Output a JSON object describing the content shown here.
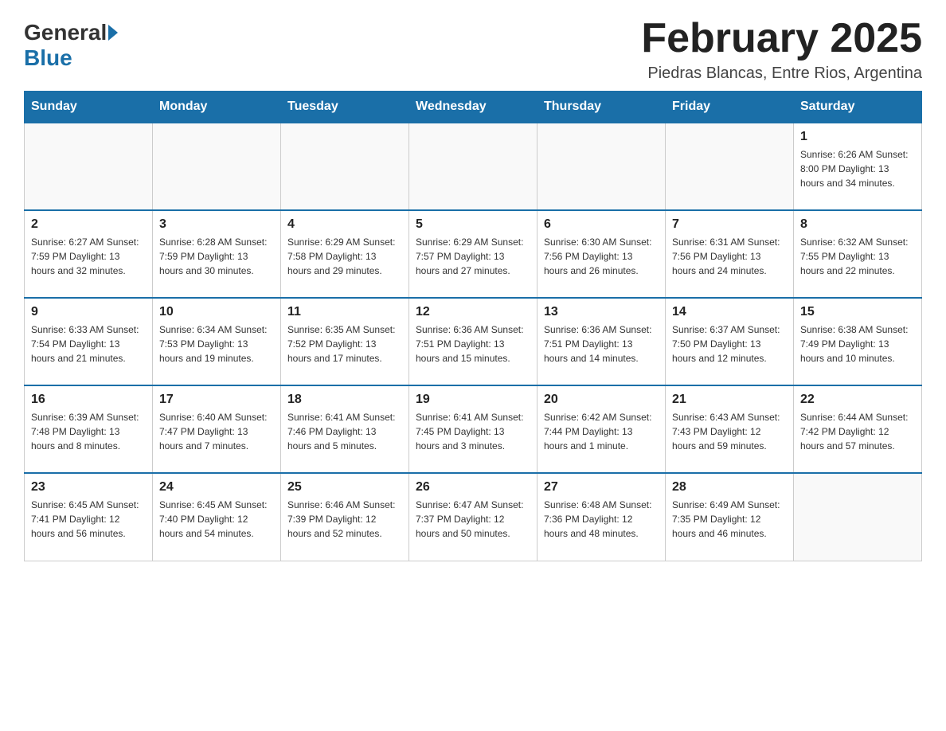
{
  "header": {
    "logo_general": "General",
    "logo_blue": "Blue",
    "title": "February 2025",
    "location": "Piedras Blancas, Entre Rios, Argentina"
  },
  "weekdays": [
    "Sunday",
    "Monday",
    "Tuesday",
    "Wednesday",
    "Thursday",
    "Friday",
    "Saturday"
  ],
  "weeks": [
    [
      {
        "day": "",
        "info": ""
      },
      {
        "day": "",
        "info": ""
      },
      {
        "day": "",
        "info": ""
      },
      {
        "day": "",
        "info": ""
      },
      {
        "day": "",
        "info": ""
      },
      {
        "day": "",
        "info": ""
      },
      {
        "day": "1",
        "info": "Sunrise: 6:26 AM\nSunset: 8:00 PM\nDaylight: 13 hours and 34 minutes."
      }
    ],
    [
      {
        "day": "2",
        "info": "Sunrise: 6:27 AM\nSunset: 7:59 PM\nDaylight: 13 hours and 32 minutes."
      },
      {
        "day": "3",
        "info": "Sunrise: 6:28 AM\nSunset: 7:59 PM\nDaylight: 13 hours and 30 minutes."
      },
      {
        "day": "4",
        "info": "Sunrise: 6:29 AM\nSunset: 7:58 PM\nDaylight: 13 hours and 29 minutes."
      },
      {
        "day": "5",
        "info": "Sunrise: 6:29 AM\nSunset: 7:57 PM\nDaylight: 13 hours and 27 minutes."
      },
      {
        "day": "6",
        "info": "Sunrise: 6:30 AM\nSunset: 7:56 PM\nDaylight: 13 hours and 26 minutes."
      },
      {
        "day": "7",
        "info": "Sunrise: 6:31 AM\nSunset: 7:56 PM\nDaylight: 13 hours and 24 minutes."
      },
      {
        "day": "8",
        "info": "Sunrise: 6:32 AM\nSunset: 7:55 PM\nDaylight: 13 hours and 22 minutes."
      }
    ],
    [
      {
        "day": "9",
        "info": "Sunrise: 6:33 AM\nSunset: 7:54 PM\nDaylight: 13 hours and 21 minutes."
      },
      {
        "day": "10",
        "info": "Sunrise: 6:34 AM\nSunset: 7:53 PM\nDaylight: 13 hours and 19 minutes."
      },
      {
        "day": "11",
        "info": "Sunrise: 6:35 AM\nSunset: 7:52 PM\nDaylight: 13 hours and 17 minutes."
      },
      {
        "day": "12",
        "info": "Sunrise: 6:36 AM\nSunset: 7:51 PM\nDaylight: 13 hours and 15 minutes."
      },
      {
        "day": "13",
        "info": "Sunrise: 6:36 AM\nSunset: 7:51 PM\nDaylight: 13 hours and 14 minutes."
      },
      {
        "day": "14",
        "info": "Sunrise: 6:37 AM\nSunset: 7:50 PM\nDaylight: 13 hours and 12 minutes."
      },
      {
        "day": "15",
        "info": "Sunrise: 6:38 AM\nSunset: 7:49 PM\nDaylight: 13 hours and 10 minutes."
      }
    ],
    [
      {
        "day": "16",
        "info": "Sunrise: 6:39 AM\nSunset: 7:48 PM\nDaylight: 13 hours and 8 minutes."
      },
      {
        "day": "17",
        "info": "Sunrise: 6:40 AM\nSunset: 7:47 PM\nDaylight: 13 hours and 7 minutes."
      },
      {
        "day": "18",
        "info": "Sunrise: 6:41 AM\nSunset: 7:46 PM\nDaylight: 13 hours and 5 minutes."
      },
      {
        "day": "19",
        "info": "Sunrise: 6:41 AM\nSunset: 7:45 PM\nDaylight: 13 hours and 3 minutes."
      },
      {
        "day": "20",
        "info": "Sunrise: 6:42 AM\nSunset: 7:44 PM\nDaylight: 13 hours and 1 minute."
      },
      {
        "day": "21",
        "info": "Sunrise: 6:43 AM\nSunset: 7:43 PM\nDaylight: 12 hours and 59 minutes."
      },
      {
        "day": "22",
        "info": "Sunrise: 6:44 AM\nSunset: 7:42 PM\nDaylight: 12 hours and 57 minutes."
      }
    ],
    [
      {
        "day": "23",
        "info": "Sunrise: 6:45 AM\nSunset: 7:41 PM\nDaylight: 12 hours and 56 minutes."
      },
      {
        "day": "24",
        "info": "Sunrise: 6:45 AM\nSunset: 7:40 PM\nDaylight: 12 hours and 54 minutes."
      },
      {
        "day": "25",
        "info": "Sunrise: 6:46 AM\nSunset: 7:39 PM\nDaylight: 12 hours and 52 minutes."
      },
      {
        "day": "26",
        "info": "Sunrise: 6:47 AM\nSunset: 7:37 PM\nDaylight: 12 hours and 50 minutes."
      },
      {
        "day": "27",
        "info": "Sunrise: 6:48 AM\nSunset: 7:36 PM\nDaylight: 12 hours and 48 minutes."
      },
      {
        "day": "28",
        "info": "Sunrise: 6:49 AM\nSunset: 7:35 PM\nDaylight: 12 hours and 46 minutes."
      },
      {
        "day": "",
        "info": ""
      }
    ]
  ]
}
